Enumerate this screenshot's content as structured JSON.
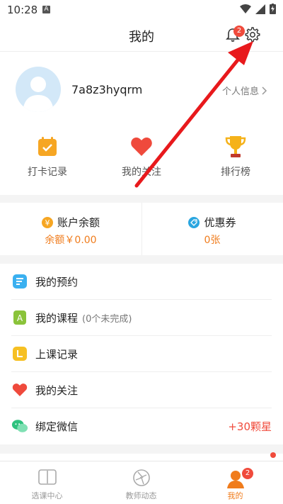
{
  "status_bar": {
    "time": "10:28"
  },
  "header": {
    "title": "我的",
    "notification_count": "2"
  },
  "profile": {
    "username": "7a8z3hyqrm",
    "personal_info_label": "个人信息"
  },
  "quick_actions": [
    {
      "label": "打卡记录",
      "icon": "calendar-check-icon"
    },
    {
      "label": "我的关注",
      "icon": "heart-icon"
    },
    {
      "label": "排行榜",
      "icon": "trophy-icon"
    }
  ],
  "balance": {
    "account_title": "账户余额",
    "account_value": "余额￥0.00",
    "coupon_title": "优惠券",
    "coupon_value": "0张"
  },
  "menu": [
    {
      "label": "我的预约",
      "icon": "appointment-icon"
    },
    {
      "label": "我的课程",
      "sub": "(0个未完成)",
      "icon": "course-icon"
    },
    {
      "label": "上课记录",
      "icon": "clock-icon"
    },
    {
      "label": "我的关注",
      "icon": "heart-icon"
    },
    {
      "label": "绑定微信",
      "right": "+30颗星",
      "icon": "wechat-icon"
    }
  ],
  "tabbar": {
    "tabs": [
      {
        "label": "选课中心"
      },
      {
        "label": "教师动态"
      },
      {
        "label": "我的"
      }
    ],
    "mine_badge": "2"
  },
  "colors": {
    "accent": "#f07c1c",
    "badge": "#f04b3c",
    "arrow": "#e8191c"
  }
}
